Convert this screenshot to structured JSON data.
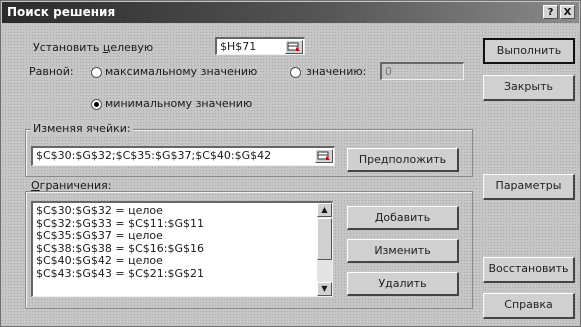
{
  "window": {
    "title": "Поиск решения",
    "help_button": "?",
    "close_button": "X"
  },
  "target": {
    "label_prefix": "Установить ",
    "label_access": "ц",
    "label_suffix": "елевую",
    "value": "$H$71"
  },
  "equal_to": {
    "label": "Равной:",
    "options": [
      {
        "label": "максимальному значению",
        "checked": false
      },
      {
        "label": "значению:",
        "checked": false
      },
      {
        "label": "минимальному значению",
        "checked": true
      }
    ],
    "value": "0"
  },
  "changing_cells": {
    "label": "Изменяя ячейки:",
    "value": "$C$30:$G$32;$C$35:$G$37;$C$40:$G$42",
    "guess_button": "Предположить"
  },
  "constraints": {
    "label_access": "О",
    "label_rest": "граничения:",
    "items": [
      "$C$30:$G$32 = целое",
      "$C$32:$G$33 = $C$11:$G$11",
      "$C$35:$G$37 = целое",
      "$C$38:$G$38 = $C$16:$G$16",
      "$C$40:$G$42 = целое",
      "$C$43:$G$43 = $C$21:$G$21"
    ],
    "add_button": "Добавить",
    "change_button": "Изменить",
    "delete_button": "Удалить"
  },
  "side_buttons": {
    "solve": "Выполнить",
    "close": "Закрыть",
    "options": "Параметры",
    "reset": "Восстановить",
    "help": "Справка"
  }
}
